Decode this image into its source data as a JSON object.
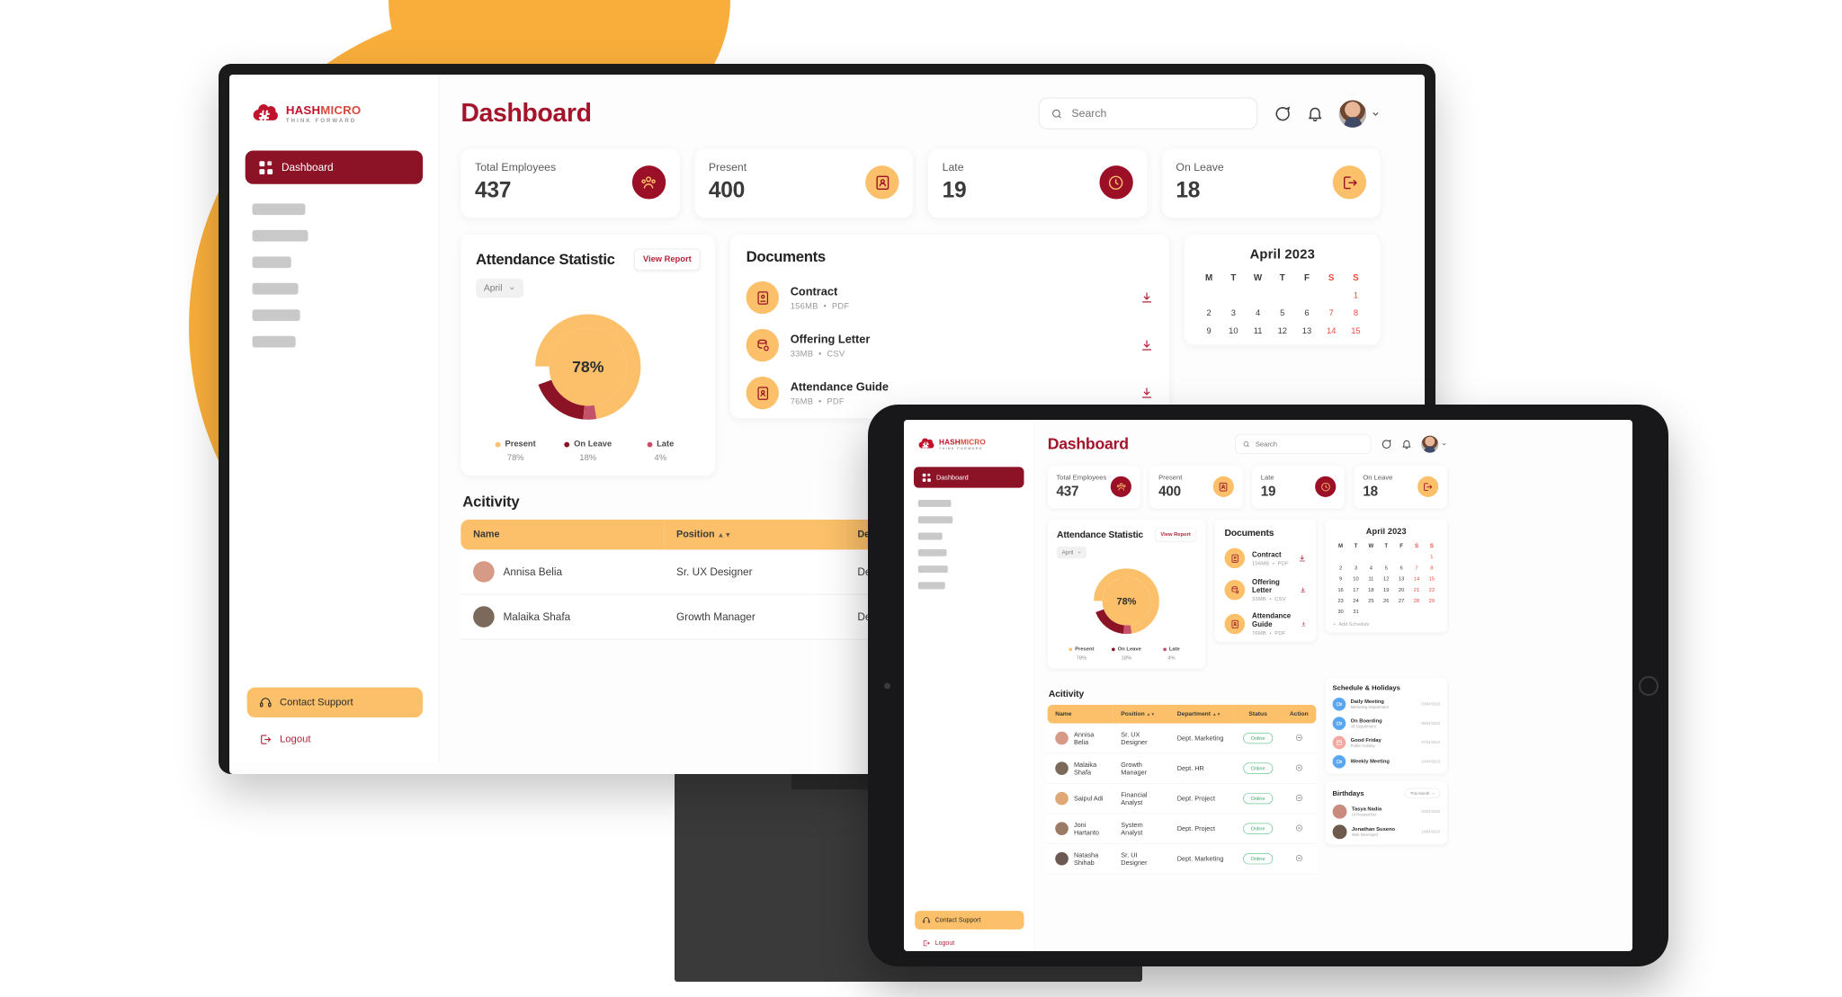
{
  "brand": {
    "logo_name_part1": "HASH",
    "logo_name_part2": "MICRO",
    "logo_tagline": "THINK FORWARD",
    "primary_red": "#A4152B",
    "dark_red": "#8C1226",
    "accent_yellow": "#FBC069",
    "orange": "#F9AE3B"
  },
  "sidebar": {
    "active_item": "Dashboard",
    "support_label": "Contact Support",
    "logout_label": "Logout",
    "placeholder_widths": [
      60,
      63,
      44,
      52,
      54,
      49
    ]
  },
  "header": {
    "title": "Dashboard",
    "search_placeholder": "Search",
    "search_value": ""
  },
  "stats": [
    {
      "label": "Total Employees",
      "value": "437",
      "icon": "people-group-icon",
      "style": "dark"
    },
    {
      "label": "Present",
      "value": "400",
      "icon": "id-card-icon",
      "style": "light"
    },
    {
      "label": "Late",
      "value": "19",
      "icon": "clock-icon",
      "style": "dark"
    },
    {
      "label": "On Leave",
      "value": "18",
      "icon": "logout-door-icon",
      "style": "light"
    }
  ],
  "attendance": {
    "title": "Attendance Statistic",
    "view_report_label": "View Report",
    "month": "April",
    "center_value": "78%"
  },
  "chart_data": {
    "type": "pie",
    "title": "Attendance Statistic",
    "subtitle": "April",
    "labels": [
      "Present",
      "On Leave",
      "Late"
    ],
    "values": [
      78,
      18,
      4
    ],
    "value_labels": [
      "78%",
      "18%",
      "4%"
    ],
    "colors": [
      "#FBC069",
      "#8C1226",
      "#C4526A"
    ],
    "center_label": "78%",
    "legend_position": "bottom",
    "donut": true
  },
  "documents": {
    "title": "Documents",
    "items": [
      {
        "name": "Contract",
        "size": "156MB",
        "type": "PDF",
        "icon": "book-document-icon"
      },
      {
        "name": "Offering Letter",
        "size": "33MB",
        "type": "CSV",
        "icon": "database-icon"
      },
      {
        "name": "Attendance Guide",
        "size": "76MB",
        "type": "PDF",
        "icon": "contact-book-icon"
      }
    ],
    "download_icon": "download-icon"
  },
  "calendar": {
    "title": "April 2023",
    "weekdays": [
      "M",
      "T",
      "W",
      "T",
      "F",
      "S",
      "S"
    ],
    "lead_blanks": 6,
    "days": [
      1,
      2,
      3,
      4,
      5,
      6,
      7,
      8,
      9,
      10,
      11,
      12,
      13,
      14,
      15,
      16,
      17,
      18,
      19,
      20,
      21,
      22,
      23,
      24,
      25,
      26,
      27,
      28,
      29,
      30,
      31
    ],
    "add_schedule_label": "Add Schedule"
  },
  "activity": {
    "title": "Acitivity",
    "columns": [
      "Name",
      "Position",
      "Department",
      "Status",
      "Action"
    ],
    "sortable": [
      "Position",
      "Department"
    ],
    "rows": [
      {
        "name": "Annisa Belia",
        "position": "Sr. UX Designer",
        "department": "Dept. Marketing",
        "status": "Online",
        "avatar": "#d79a86"
      },
      {
        "name": "Malaika Shafa",
        "position": "Growth Manager",
        "department": "Dept. HR",
        "status": "Online",
        "avatar": "#7b6a5c"
      },
      {
        "name": "Saipul Adi",
        "position": "Financial Analyst",
        "department": "Dept. Project",
        "status": "Online",
        "avatar": "#e0a877"
      },
      {
        "name": "Joni Hartanto",
        "position": "System Analyst",
        "department": "Dept. Project",
        "status": "Online",
        "avatar": "#9a7b66"
      },
      {
        "name": "Natasha Shihab",
        "position": "Sr. UI Designer",
        "department": "Dept. Marketing",
        "status": "Online",
        "avatar": "#6c5a52"
      }
    ]
  },
  "schedule": {
    "title": "Schedule & Holidays",
    "items": [
      {
        "name": "Daily Meeting",
        "sub": "Marketing Department",
        "date": "03/04/2023",
        "icon": "video-meeting-icon",
        "color": "blue"
      },
      {
        "name": "On Boarding",
        "sub": "All Department",
        "date": "05/04/2023",
        "icon": "video-meeting-icon",
        "color": "blue"
      },
      {
        "name": "Good Friday",
        "sub": "Public Holiday",
        "date": "07/04/2023",
        "icon": "calendar-icon",
        "color": "red"
      },
      {
        "name": "Weekly Meeting",
        "sub": "",
        "date": "10/04/2023",
        "icon": "video-meeting-icon",
        "color": "blue"
      }
    ]
  },
  "birthdays": {
    "title": "Birthdays",
    "filter_label": "This Month",
    "items": [
      {
        "name": "Tasya Nadia",
        "role": "UI Researcher",
        "date": "03/04/2023",
        "avatar": "#c98b7e"
      },
      {
        "name": "Jonathan Suseno",
        "role": "Web Developer",
        "date": "14/04/2023",
        "avatar": "#6d5a4e"
      }
    ]
  }
}
